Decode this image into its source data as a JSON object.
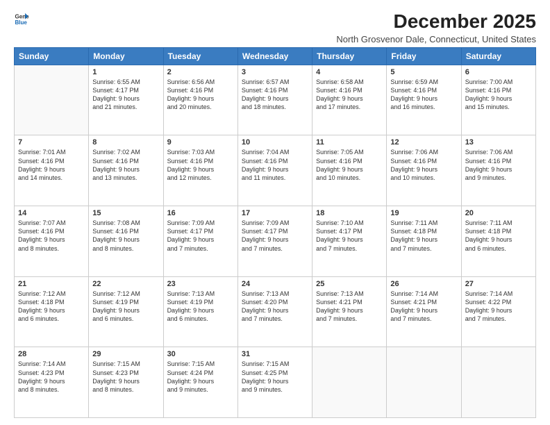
{
  "logo": {
    "line1": "General",
    "line2": "Blue"
  },
  "title": "December 2025",
  "subtitle": "North Grosvenor Dale, Connecticut, United States",
  "days_of_week": [
    "Sunday",
    "Monday",
    "Tuesday",
    "Wednesday",
    "Thursday",
    "Friday",
    "Saturday"
  ],
  "weeks": [
    [
      {
        "day": "",
        "info": ""
      },
      {
        "day": "1",
        "info": "Sunrise: 6:55 AM\nSunset: 4:17 PM\nDaylight: 9 hours\nand 21 minutes."
      },
      {
        "day": "2",
        "info": "Sunrise: 6:56 AM\nSunset: 4:16 PM\nDaylight: 9 hours\nand 20 minutes."
      },
      {
        "day": "3",
        "info": "Sunrise: 6:57 AM\nSunset: 4:16 PM\nDaylight: 9 hours\nand 18 minutes."
      },
      {
        "day": "4",
        "info": "Sunrise: 6:58 AM\nSunset: 4:16 PM\nDaylight: 9 hours\nand 17 minutes."
      },
      {
        "day": "5",
        "info": "Sunrise: 6:59 AM\nSunset: 4:16 PM\nDaylight: 9 hours\nand 16 minutes."
      },
      {
        "day": "6",
        "info": "Sunrise: 7:00 AM\nSunset: 4:16 PM\nDaylight: 9 hours\nand 15 minutes."
      }
    ],
    [
      {
        "day": "7",
        "info": "Sunrise: 7:01 AM\nSunset: 4:16 PM\nDaylight: 9 hours\nand 14 minutes."
      },
      {
        "day": "8",
        "info": "Sunrise: 7:02 AM\nSunset: 4:16 PM\nDaylight: 9 hours\nand 13 minutes."
      },
      {
        "day": "9",
        "info": "Sunrise: 7:03 AM\nSunset: 4:16 PM\nDaylight: 9 hours\nand 12 minutes."
      },
      {
        "day": "10",
        "info": "Sunrise: 7:04 AM\nSunset: 4:16 PM\nDaylight: 9 hours\nand 11 minutes."
      },
      {
        "day": "11",
        "info": "Sunrise: 7:05 AM\nSunset: 4:16 PM\nDaylight: 9 hours\nand 10 minutes."
      },
      {
        "day": "12",
        "info": "Sunrise: 7:06 AM\nSunset: 4:16 PM\nDaylight: 9 hours\nand 10 minutes."
      },
      {
        "day": "13",
        "info": "Sunrise: 7:06 AM\nSunset: 4:16 PM\nDaylight: 9 hours\nand 9 minutes."
      }
    ],
    [
      {
        "day": "14",
        "info": "Sunrise: 7:07 AM\nSunset: 4:16 PM\nDaylight: 9 hours\nand 8 minutes."
      },
      {
        "day": "15",
        "info": "Sunrise: 7:08 AM\nSunset: 4:16 PM\nDaylight: 9 hours\nand 8 minutes."
      },
      {
        "day": "16",
        "info": "Sunrise: 7:09 AM\nSunset: 4:17 PM\nDaylight: 9 hours\nand 7 minutes."
      },
      {
        "day": "17",
        "info": "Sunrise: 7:09 AM\nSunset: 4:17 PM\nDaylight: 9 hours\nand 7 minutes."
      },
      {
        "day": "18",
        "info": "Sunrise: 7:10 AM\nSunset: 4:17 PM\nDaylight: 9 hours\nand 7 minutes."
      },
      {
        "day": "19",
        "info": "Sunrise: 7:11 AM\nSunset: 4:18 PM\nDaylight: 9 hours\nand 7 minutes."
      },
      {
        "day": "20",
        "info": "Sunrise: 7:11 AM\nSunset: 4:18 PM\nDaylight: 9 hours\nand 6 minutes."
      }
    ],
    [
      {
        "day": "21",
        "info": "Sunrise: 7:12 AM\nSunset: 4:18 PM\nDaylight: 9 hours\nand 6 minutes."
      },
      {
        "day": "22",
        "info": "Sunrise: 7:12 AM\nSunset: 4:19 PM\nDaylight: 9 hours\nand 6 minutes."
      },
      {
        "day": "23",
        "info": "Sunrise: 7:13 AM\nSunset: 4:19 PM\nDaylight: 9 hours\nand 6 minutes."
      },
      {
        "day": "24",
        "info": "Sunrise: 7:13 AM\nSunset: 4:20 PM\nDaylight: 9 hours\nand 7 minutes."
      },
      {
        "day": "25",
        "info": "Sunrise: 7:13 AM\nSunset: 4:21 PM\nDaylight: 9 hours\nand 7 minutes."
      },
      {
        "day": "26",
        "info": "Sunrise: 7:14 AM\nSunset: 4:21 PM\nDaylight: 9 hours\nand 7 minutes."
      },
      {
        "day": "27",
        "info": "Sunrise: 7:14 AM\nSunset: 4:22 PM\nDaylight: 9 hours\nand 7 minutes."
      }
    ],
    [
      {
        "day": "28",
        "info": "Sunrise: 7:14 AM\nSunset: 4:23 PM\nDaylight: 9 hours\nand 8 minutes."
      },
      {
        "day": "29",
        "info": "Sunrise: 7:15 AM\nSunset: 4:23 PM\nDaylight: 9 hours\nand 8 minutes."
      },
      {
        "day": "30",
        "info": "Sunrise: 7:15 AM\nSunset: 4:24 PM\nDaylight: 9 hours\nand 9 minutes."
      },
      {
        "day": "31",
        "info": "Sunrise: 7:15 AM\nSunset: 4:25 PM\nDaylight: 9 hours\nand 9 minutes."
      },
      {
        "day": "",
        "info": ""
      },
      {
        "day": "",
        "info": ""
      },
      {
        "day": "",
        "info": ""
      }
    ]
  ]
}
